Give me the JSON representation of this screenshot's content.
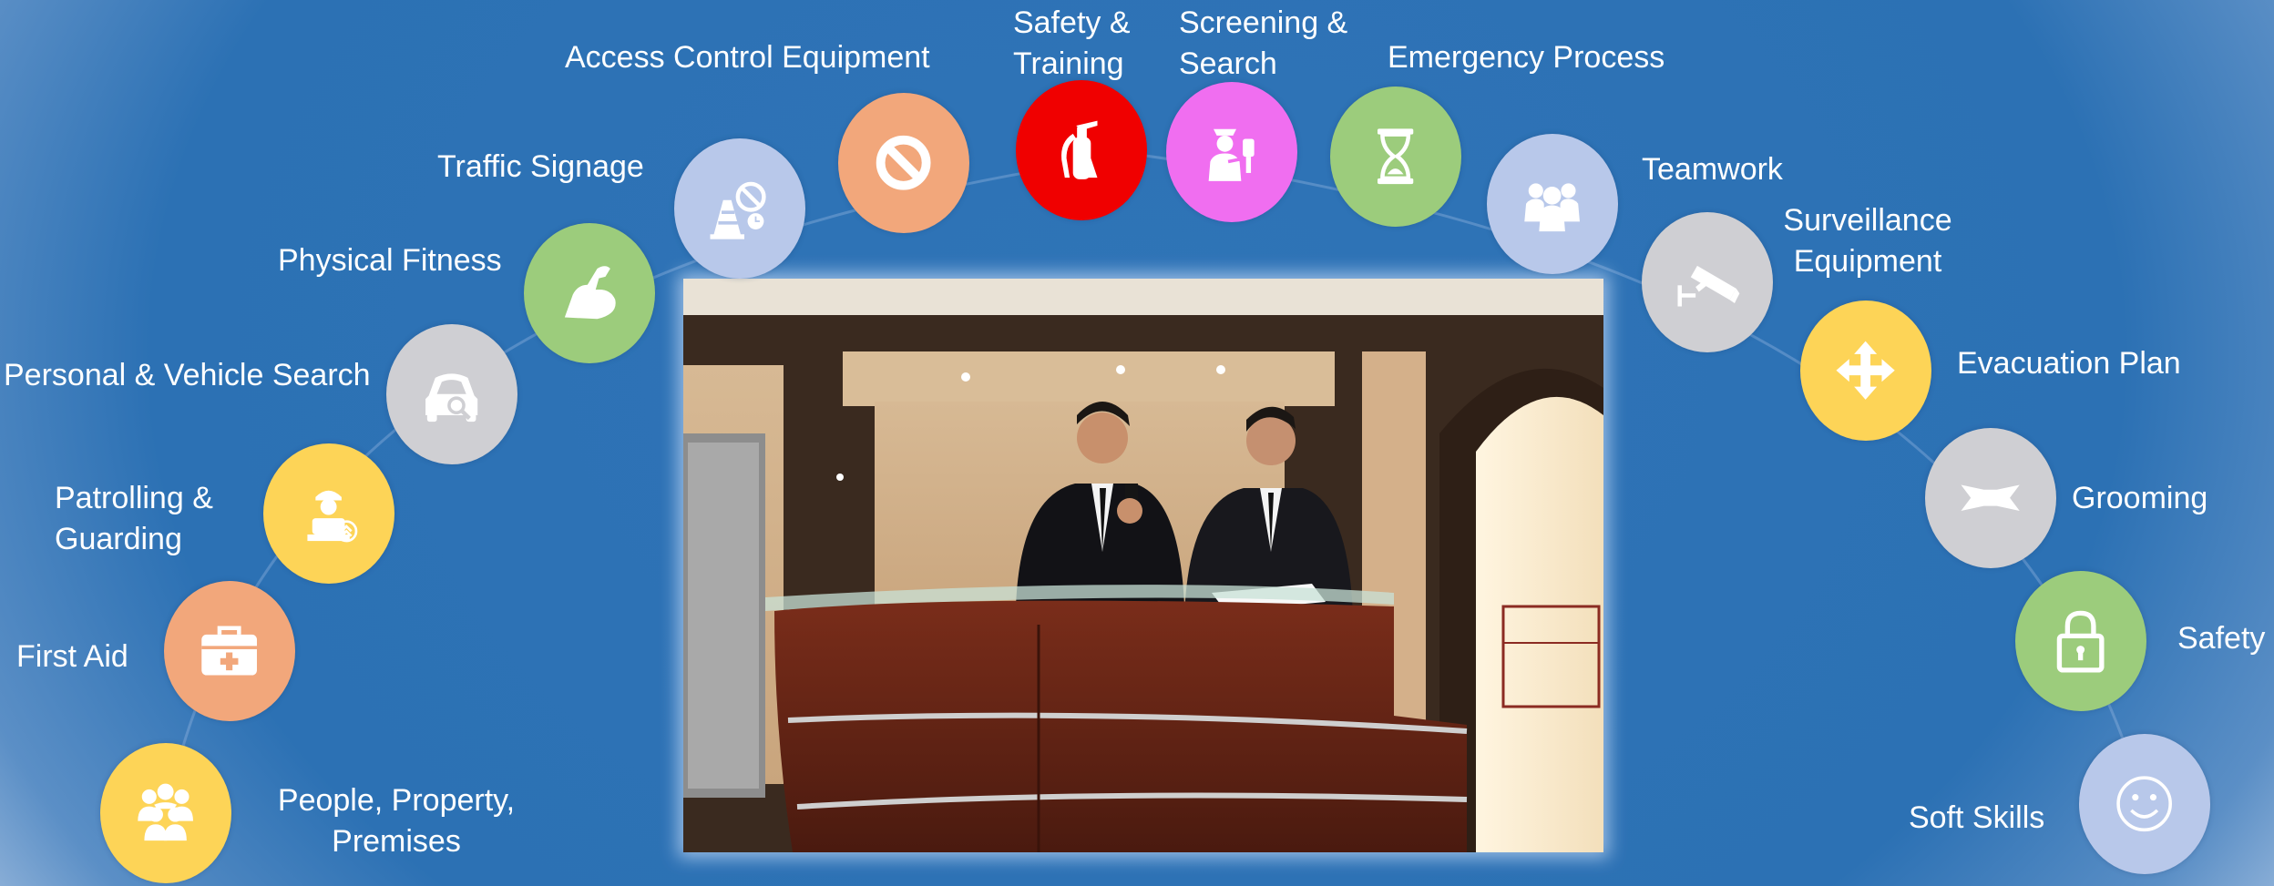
{
  "colors": {
    "background": "#2e73b6",
    "peach": "#f2a77b",
    "red": "#f00000",
    "magenta": "#f06ef0",
    "green": "#9ccc7c",
    "lavender": "#b8c8ea",
    "gray": "#cfcfd3",
    "yellow": "#fdd457"
  },
  "nodes": [
    {
      "label": "People, Property, Premises",
      "icon": "people-group-icon",
      "color": "#fdd457"
    },
    {
      "label": "First Aid",
      "icon": "first-aid-kit-icon",
      "color": "#f2a77b"
    },
    {
      "label": "Patrolling & Guarding",
      "icon": "guard-patrol-icon",
      "color": "#fdd457"
    },
    {
      "label": "Personal & Vehicle Search",
      "icon": "vehicle-search-icon",
      "color": "#cfcfd3"
    },
    {
      "label": "Physical Fitness",
      "icon": "flexed-arm-icon",
      "color": "#9ccc7c"
    },
    {
      "label": "Traffic Signage",
      "icon": "traffic-cone-icon",
      "color": "#b8c8ea"
    },
    {
      "label": "Access Control Equipment",
      "icon": "prohibited-sign-icon",
      "color": "#f2a77b"
    },
    {
      "label": "Safety & Training",
      "icon": "fire-extinguisher-icon",
      "color": "#f00000"
    },
    {
      "label": "Screening & Search",
      "icon": "screening-officer-icon",
      "color": "#f06ef0"
    },
    {
      "label": "Emergency Process",
      "icon": "hourglass-icon",
      "color": "#9ccc7c"
    },
    {
      "label": "Teamwork",
      "icon": "team-icon",
      "color": "#b8c8ea"
    },
    {
      "label": "Surveillance Equipment",
      "icon": "cctv-camera-icon",
      "color": "#cfcfd3"
    },
    {
      "label": "Evacuation Plan",
      "icon": "directions-arrows-icon",
      "color": "#fdd457"
    },
    {
      "label": "Grooming",
      "icon": "bow-tie-icon",
      "color": "#cfcfd3"
    },
    {
      "label": "Safety",
      "icon": "padlock-icon",
      "color": "#9ccc7c"
    },
    {
      "label": "Soft Skills",
      "icon": "smiley-icon",
      "color": "#b8c8ea"
    }
  ],
  "labels": {
    "people_1": "People, Property,",
    "people_2": "Premises",
    "first_aid": "First Aid",
    "patrol_1": "Patrolling &",
    "patrol_2": "Guarding",
    "search": "Personal & Vehicle Search",
    "fitness": "Physical Fitness",
    "traffic": "Traffic Signage",
    "access": "Access Control Equipment",
    "safety_training_1": "Safety &",
    "safety_training_2": "Training",
    "screening_1": "Screening &",
    "screening_2": "Search",
    "emergency": "Emergency Process",
    "teamwork": "Teamwork",
    "surveillance_1": "Surveillance",
    "surveillance_2": "Equipment",
    "evacuation": "Evacuation Plan",
    "grooming": "Grooming",
    "safety": "Safety",
    "soft_skills": "Soft Skills"
  },
  "photo": {
    "subject": "security-guards-at-reception-desk-photo"
  }
}
